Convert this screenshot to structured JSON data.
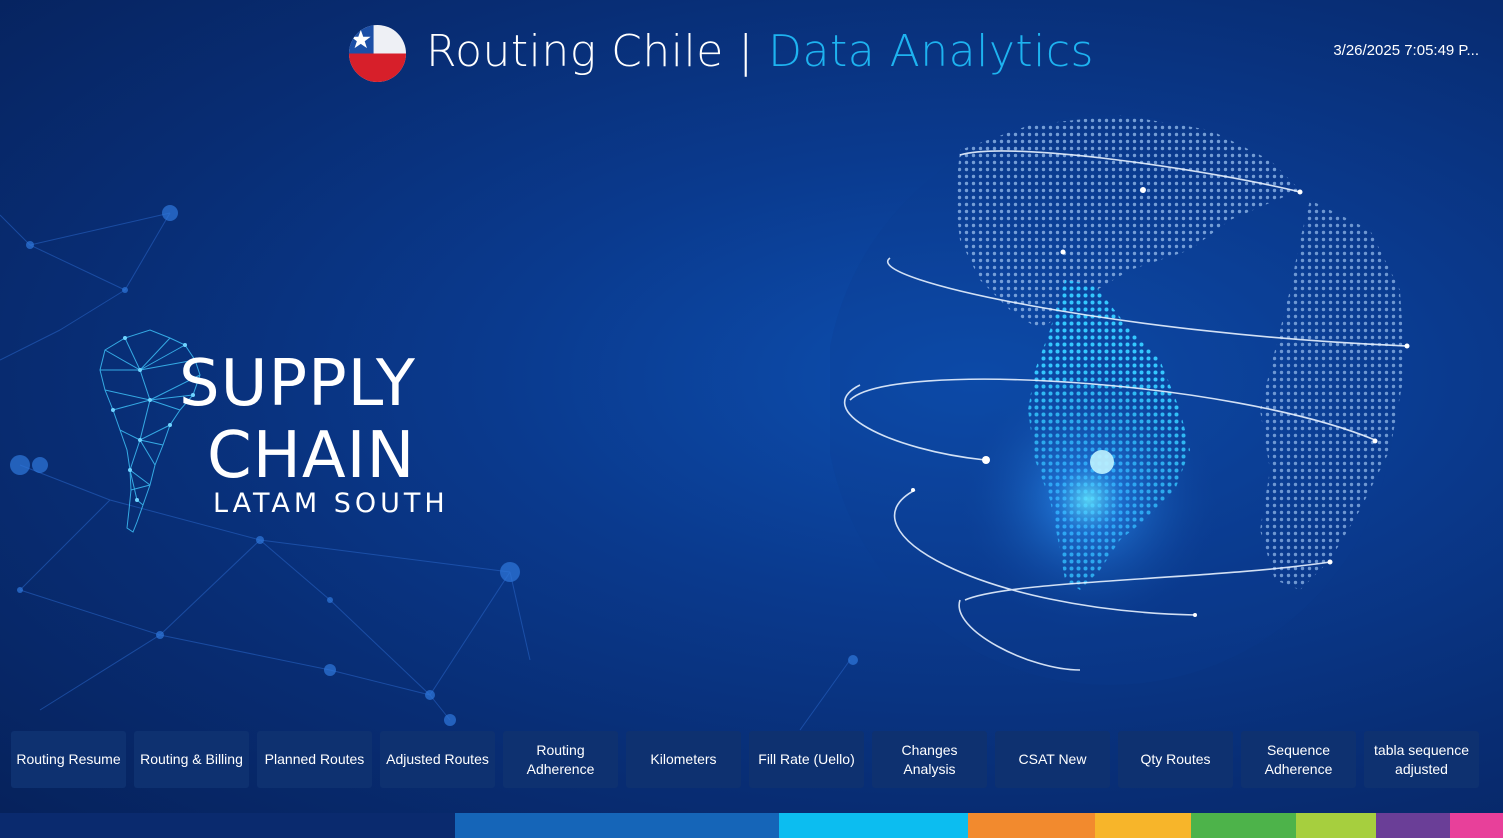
{
  "header": {
    "title_main": "Routing Chile",
    "title_sep": "|",
    "title_accent": "Data Analytics",
    "timestamp": "3/26/2025 7:05:49 P..."
  },
  "brand": {
    "line1": "SUPPLY",
    "line2": "CHAIN",
    "line3": "LATAM SOUTH"
  },
  "nav": {
    "buttons": [
      {
        "label": "Routing Resume"
      },
      {
        "label": "Routing & Billing"
      },
      {
        "label": "Planned Routes"
      },
      {
        "label": "Adjusted Routes"
      },
      {
        "label": "Routing Adherence"
      },
      {
        "label": "Kilometers"
      },
      {
        "label": "Fill Rate (Uello)"
      },
      {
        "label": "Changes Analysis"
      },
      {
        "label": "CSAT New"
      },
      {
        "label": "Qty Routes"
      },
      {
        "label": "Sequence Adherence"
      },
      {
        "label": "tabla sequence adjusted"
      }
    ]
  },
  "colors": {
    "accent": "#1eb3f0",
    "bottom_strip": [
      "#0a2a6e",
      "#1565b8",
      "#0cbdf0",
      "#f28a2e",
      "#f7b52a",
      "#4db34a",
      "#a6cf3e",
      "#6a3e97",
      "#e8409a"
    ]
  },
  "icons": {
    "flag": "chile-flag-icon",
    "globe": "globe-illustration"
  }
}
